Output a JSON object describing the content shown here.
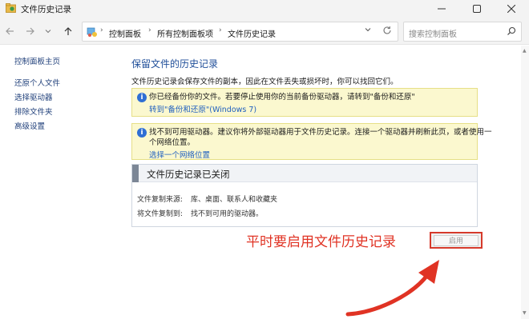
{
  "window": {
    "title": "文件历史记录",
    "colors": {
      "accent": "#1f4e99",
      "link": "#1f5fbf",
      "annotation": "#e03324",
      "info_bg": "#fbf8cf"
    }
  },
  "address": {
    "breadcrumbs": [
      "控制面板",
      "所有控制面板项",
      "文件历史记录"
    ],
    "search_placeholder": "搜索控制面板"
  },
  "sidebar": {
    "items": [
      {
        "label": "控制面板主页"
      },
      {
        "label": "还原个人文件"
      },
      {
        "label": "选择驱动器"
      },
      {
        "label": "排除文件夹"
      },
      {
        "label": "高级设置"
      }
    ]
  },
  "main": {
    "heading": "保留文件的历史记录",
    "description": "文件历史记录会保存文件的副本，因此在文件丢失或损坏时，你可以找回它们。",
    "info1": {
      "text": "你已经备份你的文件。若要停止使用你的当前备份驱动器，请转到\"备份和还原\"",
      "link": "转到\"备份和还原\"(Windows 7)"
    },
    "info2": {
      "line1": "找不到可用驱动器。建议你将外部驱动器用于文件历史记录。连接一个驱动器并刷新此页，或者使用一",
      "line2": "个网络位置。",
      "link": "选择一个网络位置"
    },
    "status": {
      "title": "文件历史记录已关闭",
      "copy_from_label": "文件复制来源:",
      "copy_from_value": "库、桌面、联系人和收藏夹",
      "copy_to_label": "将文件复制到:",
      "copy_to_value": "找不到可用的驱动器。"
    },
    "enable_button": "启用",
    "annotation": "平时要启用文件历史记录"
  }
}
